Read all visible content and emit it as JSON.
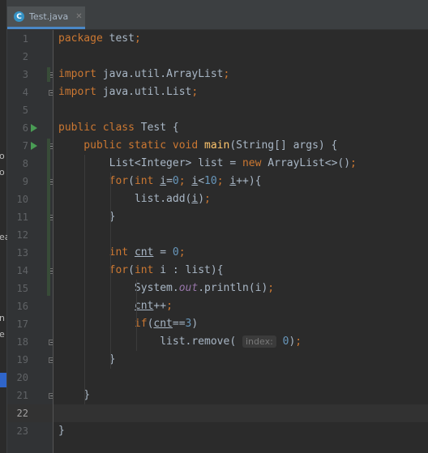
{
  "tab": {
    "icon": "C",
    "title": "Test.java",
    "close": "✕"
  },
  "side_fragments": [
    "o",
    "o",
    "ea",
    "n",
    "e"
  ],
  "lines": [
    {
      "n": "1",
      "tokens": [
        {
          "t": "package ",
          "c": "kw"
        },
        {
          "t": "test",
          "c": ""
        },
        {
          "t": ";",
          "c": "kw"
        }
      ]
    },
    {
      "n": "2",
      "tokens": []
    },
    {
      "n": "3",
      "tokens": [
        {
          "t": "import ",
          "c": "kw"
        },
        {
          "t": "java.util.ArrayList",
          "c": ""
        },
        {
          "t": ";",
          "c": "kw"
        }
      ]
    },
    {
      "n": "4",
      "tokens": [
        {
          "t": "import ",
          "c": "kw"
        },
        {
          "t": "java.util.List",
          "c": ""
        },
        {
          "t": ";",
          "c": "kw"
        }
      ]
    },
    {
      "n": "5",
      "tokens": []
    },
    {
      "n": "6",
      "tokens": [
        {
          "t": "public class ",
          "c": "kw"
        },
        {
          "t": "Test {",
          "c": ""
        }
      ]
    },
    {
      "n": "7",
      "tokens": [
        {
          "t": "    public static void ",
          "c": "kw"
        },
        {
          "t": "main",
          "c": "fn"
        },
        {
          "t": "(String[] args) {",
          "c": ""
        }
      ]
    },
    {
      "n": "8",
      "tokens": [
        {
          "t": "        List<Integer> list = ",
          "c": ""
        },
        {
          "t": "new ",
          "c": "kw"
        },
        {
          "t": "ArrayList<>()",
          "c": ""
        },
        {
          "t": ";",
          "c": "kw"
        }
      ]
    },
    {
      "n": "9",
      "tokens": [
        {
          "t": "        ",
          "c": ""
        },
        {
          "t": "for",
          "c": "kw"
        },
        {
          "t": "(",
          "c": ""
        },
        {
          "t": "int ",
          "c": "kw"
        },
        {
          "t": "i",
          "c": "ul"
        },
        {
          "t": "=",
          "c": ""
        },
        {
          "t": "0",
          "c": "num"
        },
        {
          "t": "; ",
          "c": "kw"
        },
        {
          "t": "i",
          "c": "ul"
        },
        {
          "t": "<",
          "c": ""
        },
        {
          "t": "10",
          "c": "num"
        },
        {
          "t": "; ",
          "c": "kw"
        },
        {
          "t": "i",
          "c": "ul"
        },
        {
          "t": "++){",
          "c": ""
        }
      ]
    },
    {
      "n": "10",
      "tokens": [
        {
          "t": "            list.add(",
          "c": ""
        },
        {
          "t": "i",
          "c": "ul"
        },
        {
          "t": ")",
          "c": ""
        },
        {
          "t": ";",
          "c": "kw"
        }
      ]
    },
    {
      "n": "11",
      "tokens": [
        {
          "t": "        }",
          "c": ""
        }
      ]
    },
    {
      "n": "12",
      "tokens": []
    },
    {
      "n": "13",
      "tokens": [
        {
          "t": "        ",
          "c": ""
        },
        {
          "t": "int ",
          "c": "kw"
        },
        {
          "t": "cnt",
          "c": "ul"
        },
        {
          "t": " = ",
          "c": ""
        },
        {
          "t": "0",
          "c": "num"
        },
        {
          "t": ";",
          "c": "kw"
        }
      ]
    },
    {
      "n": "14",
      "tokens": [
        {
          "t": "        ",
          "c": ""
        },
        {
          "t": "for",
          "c": "kw"
        },
        {
          "t": "(",
          "c": ""
        },
        {
          "t": "int ",
          "c": "kw"
        },
        {
          "t": "i : list){",
          "c": ""
        }
      ]
    },
    {
      "n": "15",
      "tokens": [
        {
          "t": "            System.",
          "c": ""
        },
        {
          "t": "out",
          "c": "it"
        },
        {
          "t": ".println(i)",
          "c": ""
        },
        {
          "t": ";",
          "c": "kw"
        }
      ]
    },
    {
      "n": "16",
      "tokens": [
        {
          "t": "            ",
          "c": ""
        },
        {
          "t": "cnt",
          "c": "ul"
        },
        {
          "t": "++",
          "c": ""
        },
        {
          "t": ";",
          "c": "kw"
        }
      ]
    },
    {
      "n": "17",
      "tokens": [
        {
          "t": "            ",
          "c": ""
        },
        {
          "t": "if",
          "c": "kw"
        },
        {
          "t": "(",
          "c": ""
        },
        {
          "t": "cnt",
          "c": "ul"
        },
        {
          "t": "==",
          "c": ""
        },
        {
          "t": "3",
          "c": "num"
        },
        {
          "t": ")",
          "c": ""
        }
      ]
    },
    {
      "n": "18",
      "tokens": [
        {
          "t": "                list.remove( ",
          "c": ""
        },
        {
          "t": "index:",
          "c": "hint"
        },
        {
          "t": " ",
          "c": ""
        },
        {
          "t": "0",
          "c": "num"
        },
        {
          "t": ")",
          "c": ""
        },
        {
          "t": ";",
          "c": "kw"
        }
      ]
    },
    {
      "n": "19",
      "tokens": [
        {
          "t": "        }",
          "c": ""
        }
      ]
    },
    {
      "n": "20",
      "tokens": []
    },
    {
      "n": "21",
      "tokens": [
        {
          "t": "    }",
          "c": ""
        }
      ]
    },
    {
      "n": "22",
      "tokens": []
    },
    {
      "n": "23",
      "tokens": [
        {
          "t": "}",
          "c": ""
        }
      ]
    }
  ],
  "current_line": "22",
  "colors": {
    "keyword": "#cc7832",
    "number": "#6897bb",
    "method": "#ffc66d",
    "field": "#9876aa",
    "text": "#a9b7c6",
    "run": "#499c54"
  }
}
